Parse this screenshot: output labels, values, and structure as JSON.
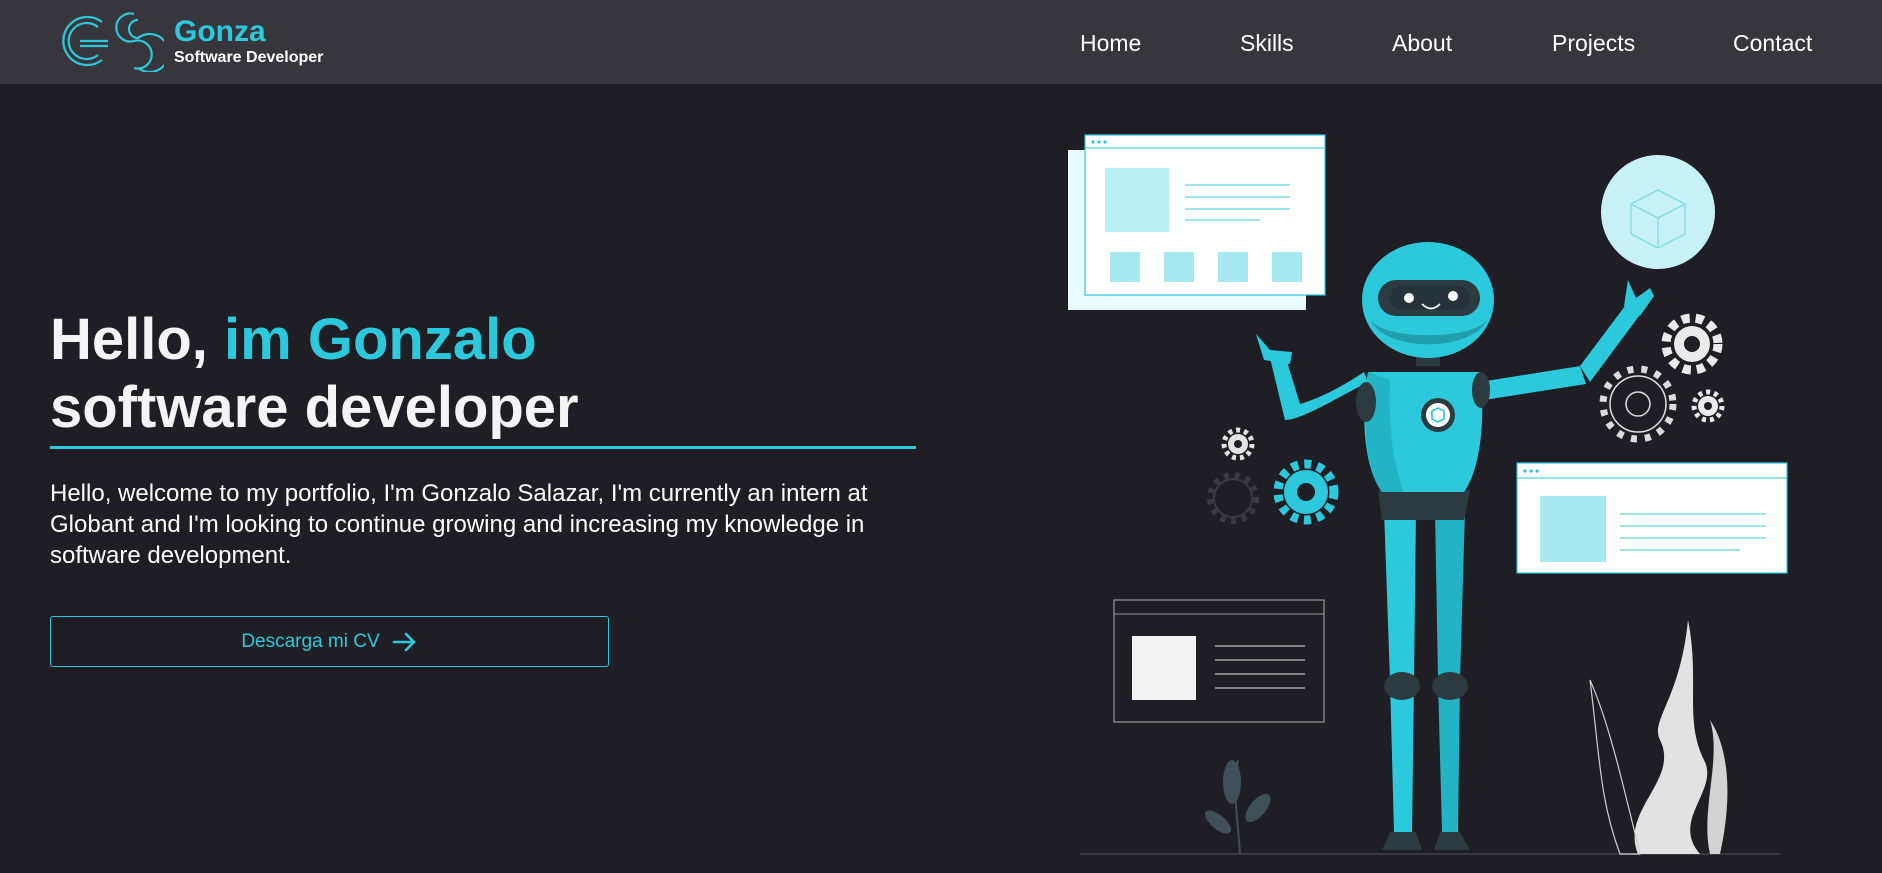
{
  "brand": {
    "name": "Gonza",
    "role": "Software Developer",
    "logo_icon": "gs-monogram-icon"
  },
  "nav": {
    "items": [
      {
        "label": "Home"
      },
      {
        "label": "Skills"
      },
      {
        "label": "About"
      },
      {
        "label": "Projects"
      },
      {
        "label": "Contact"
      }
    ]
  },
  "hero": {
    "title_prefix": "Hello,",
    "title_accent": "im Gonzalo",
    "title_line2": "software developer",
    "description": "Hello, welcome to my portfolio, I'm Gonzalo Salazar, I'm currently an intern at Globant and I'm looking to continue growing and increasing my knowledge in software development.",
    "cv_button_label": "Descarga mi CV",
    "cv_button_icon": "arrow-right-icon",
    "illustration_icon": "robot-illustration"
  },
  "colors": {
    "background": "#1f1e25",
    "navbar": "#37363c",
    "accent": "#2cc9dc",
    "text": "#ffffff"
  }
}
